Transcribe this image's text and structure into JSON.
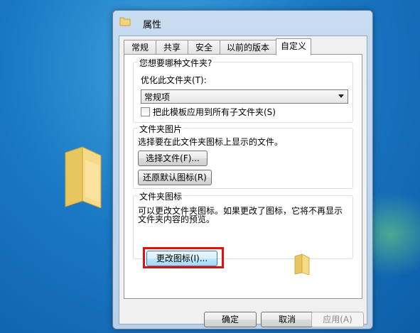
{
  "window": {
    "title": "属性"
  },
  "tabs": [
    {
      "label": "常规"
    },
    {
      "label": "共享"
    },
    {
      "label": "安全"
    },
    {
      "label": "以前的版本"
    },
    {
      "label": "自定义"
    }
  ],
  "optimize_group": {
    "title": "您想要哪种文件夹?",
    "optimize_label": "优化此文件夹(T):",
    "optimize_value": "常规项",
    "apply_subfolders_label": "把此模板应用到所有子文件夹(S)",
    "apply_subfolders_checked": false
  },
  "picture_group": {
    "title": "文件夹图片",
    "description": "选择要在此文件夹图标上显示的文件。",
    "choose_file_button": "选择文件(F)...",
    "restore_default_button": "还原默认图标(R)"
  },
  "icon_group": {
    "title": "文件夹图标",
    "description_line1": "可以更改文件夹图标。如果更改了图标，它将不再显示",
    "description_line2": "文件夹内容的预览。",
    "change_icon_button": "更改图标(I)..."
  },
  "footer": {
    "ok_button": "确定",
    "cancel_button": "取消",
    "apply_button": "应用(A)"
  },
  "colors": {
    "desktop": "#1b78c4",
    "highlight_box": "#e01010",
    "folder": "#f2d27a"
  }
}
